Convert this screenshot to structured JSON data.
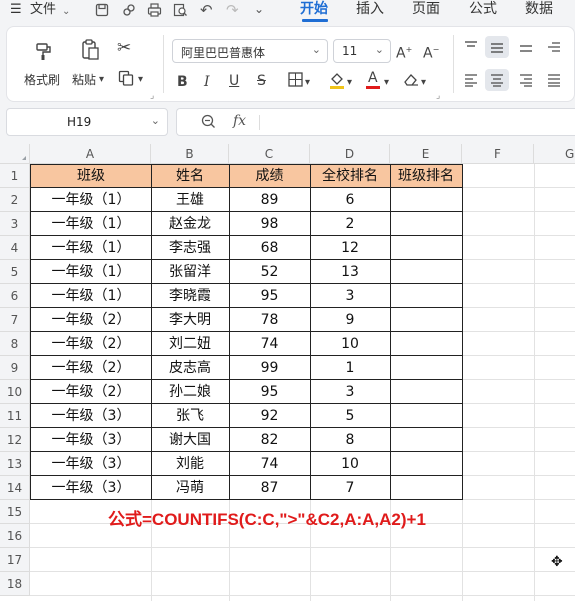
{
  "menubar": {
    "menu_icon": "☰",
    "file_label": "文件",
    "tabs": {
      "home": "开始",
      "insert": "插入",
      "page": "页面",
      "formula": "公式",
      "data": "数据"
    }
  },
  "ribbon": {
    "format_painter_label": "格式刷",
    "paste_label": "粘贴",
    "font_name": "阿里巴巴普惠体",
    "font_size": "11"
  },
  "formula_bar": {
    "cell_ref": "H19",
    "fx_label": "fx",
    "formula_value": ""
  },
  "sheet": {
    "columns": [
      "A",
      "B",
      "C",
      "D",
      "E",
      "F",
      "G"
    ],
    "row_numbers": [
      "1",
      "2",
      "3",
      "4",
      "5",
      "6",
      "7",
      "8",
      "9",
      "10",
      "11",
      "12",
      "13",
      "14",
      "15",
      "16",
      "17",
      "18"
    ],
    "headers": [
      "班级",
      "姓名",
      "成绩",
      "全校排名",
      "班级排名"
    ],
    "rows": [
      [
        "一年级（1）",
        "王雄",
        "89",
        "6",
        ""
      ],
      [
        "一年级（1）",
        "赵金龙",
        "98",
        "2",
        ""
      ],
      [
        "一年级（1）",
        "李志强",
        "68",
        "12",
        ""
      ],
      [
        "一年级（1）",
        "张留洋",
        "52",
        "13",
        ""
      ],
      [
        "一年级（1）",
        "李晓霞",
        "95",
        "3",
        ""
      ],
      [
        "一年级（2）",
        "李大明",
        "78",
        "9",
        ""
      ],
      [
        "一年级（2）",
        "刘二妞",
        "74",
        "10",
        ""
      ],
      [
        "一年级（2）",
        "皮志高",
        "99",
        "1",
        ""
      ],
      [
        "一年级（2）",
        "孙二娘",
        "95",
        "3",
        ""
      ],
      [
        "一年级（3）",
        "张飞",
        "92",
        "5",
        ""
      ],
      [
        "一年级（3）",
        "谢大国",
        "82",
        "8",
        ""
      ],
      [
        "一年级（3）",
        "刘能",
        "74",
        "10",
        ""
      ],
      [
        "一年级（3）",
        "冯萌",
        "87",
        "7",
        ""
      ]
    ],
    "formula_note": "公式=COUNTIFS(C:C,\">\"&C2,A:A,A2)+1"
  },
  "colors": {
    "accent": "#1f6ed4",
    "header_fill": "#f8c6a0",
    "note_red": "#e01b1b"
  }
}
